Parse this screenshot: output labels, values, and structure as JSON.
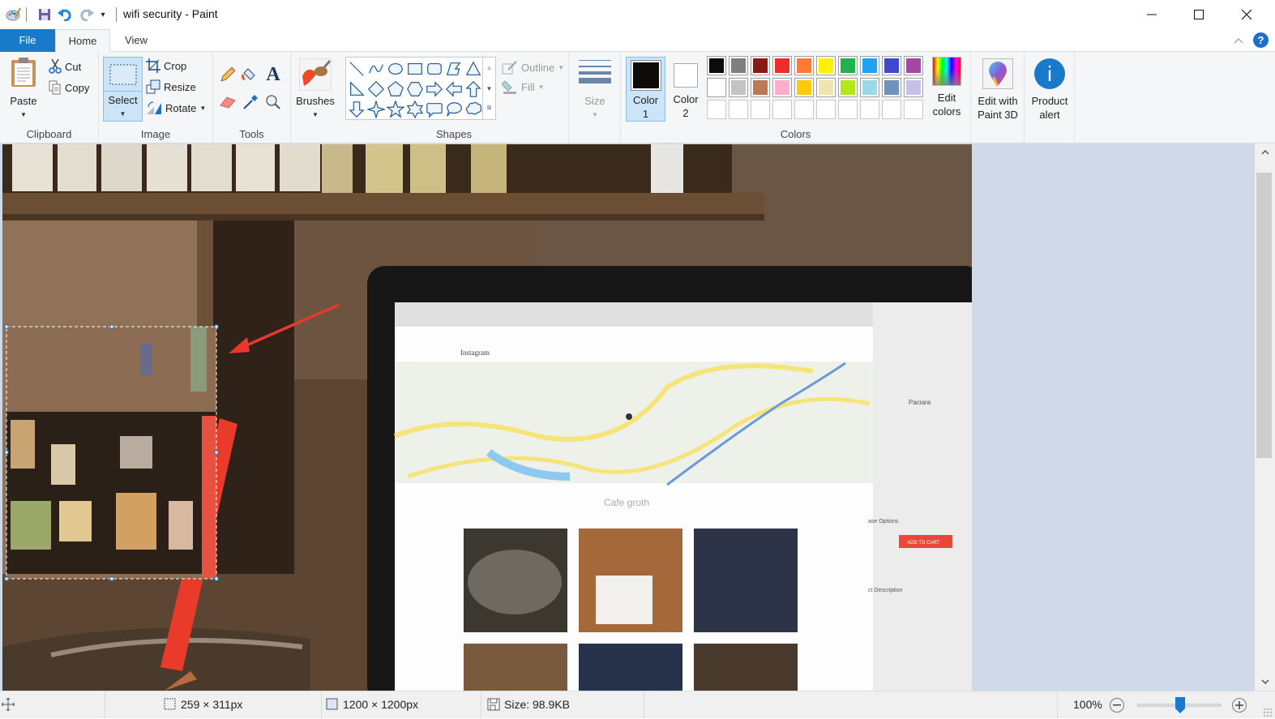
{
  "window": {
    "title": "wifi security - Paint",
    "controls": {
      "minimize": "minimize-icon",
      "maximize": "maximize-icon",
      "close": "close-icon"
    }
  },
  "quick_access": {
    "icons": [
      "paint-app-icon",
      "save-icon",
      "undo-icon",
      "redo-icon",
      "customize-dropdown-icon"
    ]
  },
  "tabs": [
    {
      "label": "File",
      "active": false
    },
    {
      "label": "Home",
      "active": true
    },
    {
      "label": "View",
      "active": false
    }
  ],
  "ribbon": {
    "clipboard": {
      "label": "Clipboard",
      "paste": "Paste",
      "cut": "Cut",
      "copy": "Copy"
    },
    "image": {
      "label": "Image",
      "select": "Select",
      "crop": "Crop",
      "resize": "Resize",
      "rotate": "Rotate"
    },
    "tools": {
      "label": "Tools",
      "items": [
        "pencil-icon",
        "fill-bucket-icon",
        "text-icon",
        "eraser-icon",
        "color-picker-icon",
        "magnifier-icon"
      ]
    },
    "brushes": {
      "label": "Brushes"
    },
    "shapes": {
      "label": "Shapes",
      "outline": "Outline",
      "fill": "Fill",
      "items": [
        "line",
        "curve",
        "oval",
        "rectangle",
        "rounded-rectangle",
        "polygon",
        "triangle",
        "right-triangle",
        "diamond",
        "pentagon",
        "hexagon",
        "right-arrow",
        "left-arrow",
        "up-arrow",
        "down-arrow",
        "four-point-star",
        "five-point-star",
        "six-point-star",
        "rounded-callout",
        "oval-callout",
        "cloud-callout"
      ]
    },
    "size": {
      "label": "Size"
    },
    "colors": {
      "label": "Colors",
      "color1_label": "Color",
      "color1_num": "1",
      "color2_label": "Color",
      "color2_num": "2",
      "color1": "#0e0b0a",
      "color2": "#ffffff",
      "palette_row1": [
        "#0e0b0a",
        "#7f7f7f",
        "#881b16",
        "#ec2f26",
        "#ff7a35",
        "#fff200",
        "#22b14c",
        "#1fa3f0",
        "#3f48cc",
        "#a349a4"
      ],
      "palette_row2": [
        "#ffffff",
        "#c3c3c3",
        "#b97a57",
        "#ffaec9",
        "#ffc90e",
        "#efe4b0",
        "#b5e61d",
        "#99d9ea",
        "#7092be",
        "#c8bfe7"
      ],
      "edit_colors_line1": "Edit",
      "edit_colors_line2": "colors"
    },
    "paint3d": {
      "line1": "Edit with",
      "line2": "Paint 3D"
    },
    "product_alert": {
      "line1": "Product",
      "line2": "alert"
    }
  },
  "canvas": {
    "image_description": "Cafe photo: shelf of bottles, laptop showing Instagram map page 'Cafe groth', copper mug with red straw; pixelated selected region with red arrow",
    "screen_text": {
      "site_title": "Cafe groth",
      "brand": "Instagram",
      "side_title": "Paciara",
      "add_to_cart": "ADD TO CART",
      "purchase_options": "ase Options",
      "product_description": "ct Description"
    }
  },
  "status": {
    "selection_size": "259 × 311px",
    "image_size": "1200 × 1200px",
    "file_size": "Size: 98.9KB",
    "zoom": "100%",
    "zoom_fraction": 0.5
  }
}
